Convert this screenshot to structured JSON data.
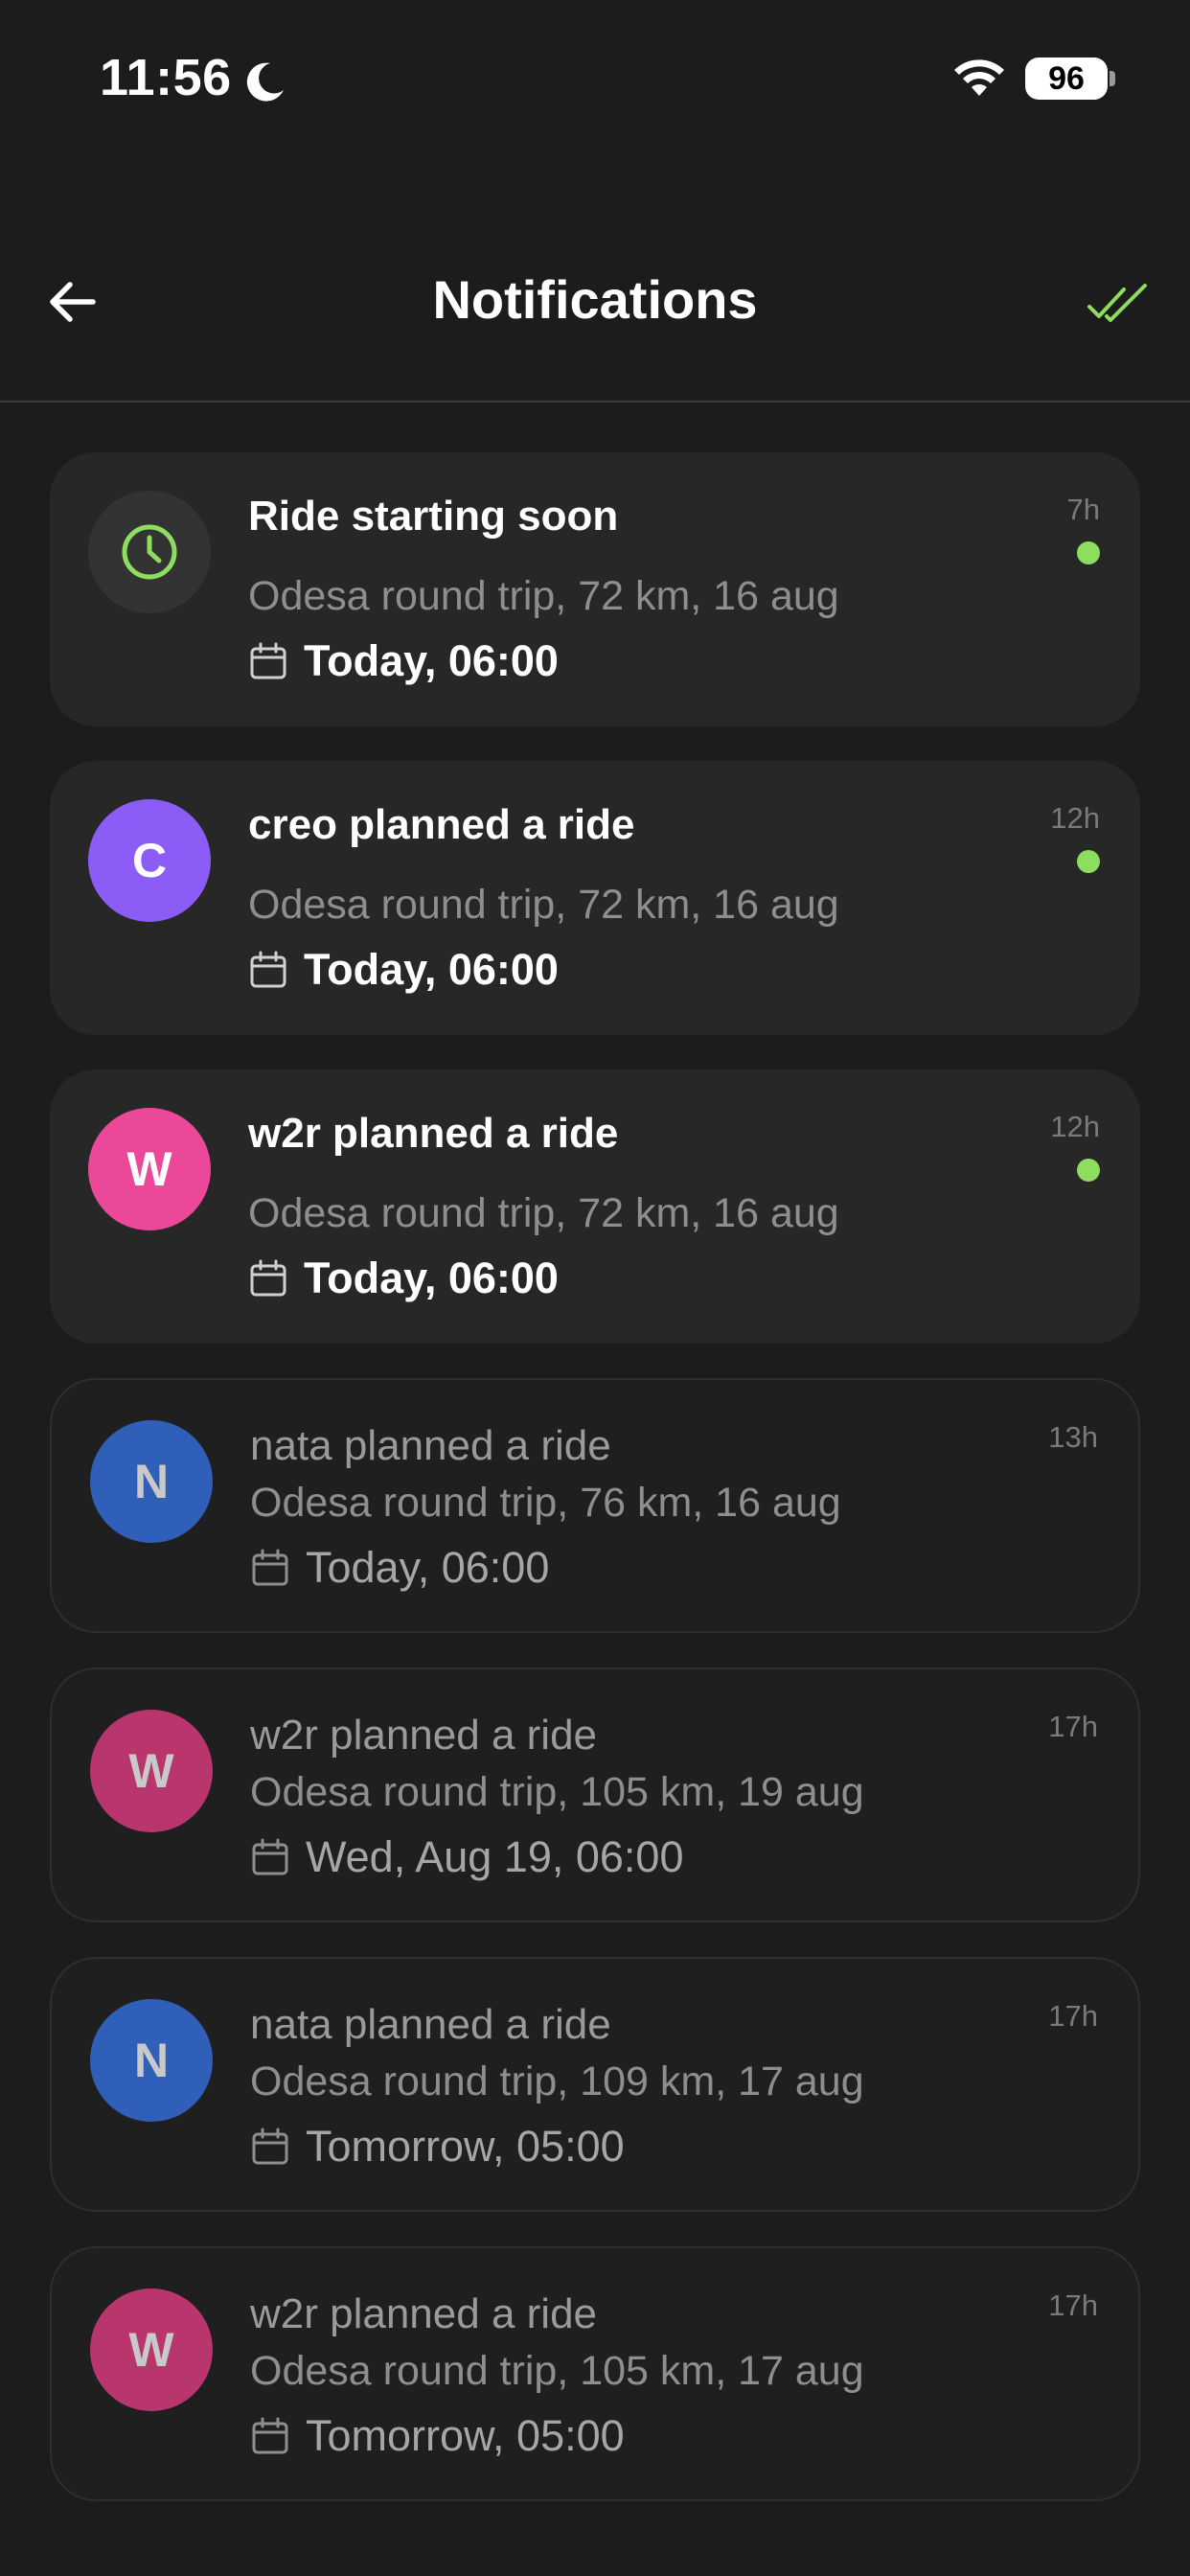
{
  "status_bar": {
    "time": "11:56",
    "battery": "96"
  },
  "header": {
    "title": "Notifications"
  },
  "colors": {
    "accent": "#8ddd5e",
    "background": "#1c1c1c"
  },
  "notifications": [
    {
      "title": "Ride starting soon",
      "subtitle": "Odesa round trip, 72 km, 16 aug",
      "date": "Today, 06:00",
      "time_ago": "7h",
      "unread": true,
      "avatar_type": "clock-icon",
      "avatar_color": "#333333"
    },
    {
      "title": "creo planned a ride",
      "subtitle": "Odesa round trip, 72 km, 16 aug",
      "date": "Today, 06:00",
      "time_ago": "12h",
      "unread": true,
      "avatar_letter": "C",
      "avatar_color": "#8b5cf6"
    },
    {
      "title": "w2r planned a ride",
      "subtitle": "Odesa round trip, 72 km, 16 aug",
      "date": "Today, 06:00",
      "time_ago": "12h",
      "unread": true,
      "avatar_letter": "W",
      "avatar_color": "#ec4899"
    },
    {
      "title": "nata planned a ride",
      "subtitle": "Odesa round trip, 76 km, 16 aug",
      "date": "Today, 06:00",
      "time_ago": "13h",
      "unread": false,
      "avatar_letter": "N",
      "avatar_color": "#2f5fb8"
    },
    {
      "title": "w2r planned a ride",
      "subtitle": "Odesa round trip, 105 km, 19 aug",
      "date": "Wed, Aug 19, 06:00",
      "time_ago": "17h",
      "unread": false,
      "avatar_letter": "W",
      "avatar_color": "#b8356e"
    },
    {
      "title": "nata planned a ride",
      "subtitle": "Odesa round trip, 109 km, 17 aug",
      "date": "Tomorrow, 05:00",
      "time_ago": "17h",
      "unread": false,
      "avatar_letter": "N",
      "avatar_color": "#2f5fb8"
    },
    {
      "title": "w2r planned a ride",
      "subtitle": "Odesa round trip, 105 km, 17 aug",
      "date": "Tomorrow, 05:00",
      "time_ago": "17h",
      "unread": false,
      "avatar_letter": "W",
      "avatar_color": "#b8356e"
    }
  ]
}
